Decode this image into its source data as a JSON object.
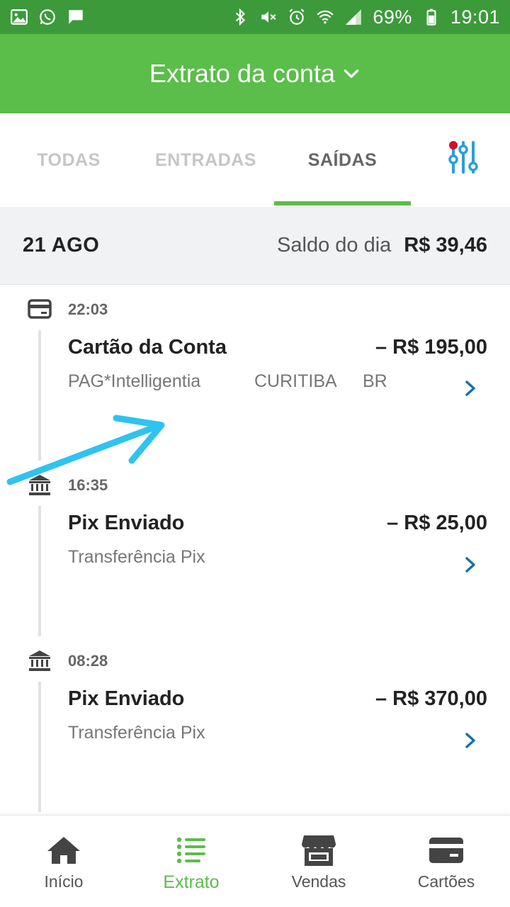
{
  "status_bar": {
    "battery": "69%",
    "time": "19:01",
    "left_icons": [
      "image-icon",
      "whatsapp-icon",
      "chat-icon"
    ],
    "right_icons": [
      "bluetooth-icon",
      "mute-icon",
      "alarm-icon",
      "wifi-icon",
      "signal-icon",
      "battery-icon"
    ]
  },
  "app_bar": {
    "title": "Extrato da conta",
    "dropdown_icon": "chevron-down-icon"
  },
  "tabs": [
    {
      "label": "TODAS",
      "active": false
    },
    {
      "label": "ENTRADAS",
      "active": false
    },
    {
      "label": "SAÍDAS",
      "active": true
    }
  ],
  "filter_icon": "sliders-icon",
  "day": {
    "date": "21 AGO",
    "balance_label": "Saldo do dia",
    "balance_value": "R$ 39,46"
  },
  "transactions": [
    {
      "icon": "card-icon",
      "time": "22:03",
      "title": "Cartão da Conta",
      "amount": "– R$ 195,00",
      "details": [
        "PAG*Intelligentia",
        "CURITIBA",
        "BR"
      ]
    },
    {
      "icon": "bank-icon",
      "time": "16:35",
      "title": "Pix Enviado",
      "amount": "– R$ 25,00",
      "details": [
        "Transferência Pix"
      ]
    },
    {
      "icon": "bank-icon",
      "time": "08:28",
      "title": "Pix Enviado",
      "amount": "– R$ 370,00",
      "details": [
        "Transferência Pix"
      ]
    }
  ],
  "bottom_nav": [
    {
      "label": "Início",
      "icon": "home-icon",
      "active": false
    },
    {
      "label": "Extrato",
      "icon": "list-icon",
      "active": true
    },
    {
      "label": "Vendas",
      "icon": "store-icon",
      "active": false
    },
    {
      "label": "Cartões",
      "icon": "card-icon",
      "active": false
    }
  ],
  "colors": {
    "status_bar": "#3c9a3a",
    "app_bar": "#5bbd4a",
    "accent_green": "#5bbd4a",
    "chevron_blue": "#1a6fa8",
    "annotation_arrow": "#2fc3ef",
    "filter_icon_blue": "#2a9fd6",
    "filter_dot_red": "#d0102a"
  }
}
